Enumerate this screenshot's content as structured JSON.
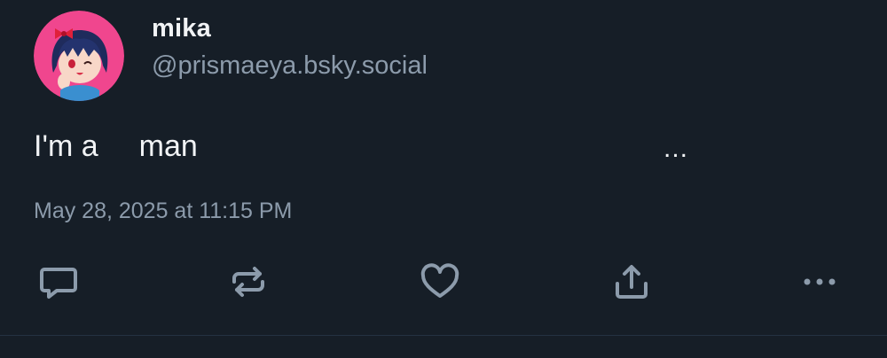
{
  "post": {
    "author": {
      "display_name": "mika",
      "handle": "@prismaeya.bsky.social",
      "avatar_icon": "anime-avatar"
    },
    "text_before": "I'm a",
    "text_after": "man",
    "inline_menu": "...",
    "timestamp": "May 28, 2025 at 11:15 PM"
  },
  "actions": {
    "reply_icon": "reply-icon",
    "repost_icon": "repost-icon",
    "like_icon": "heart-icon",
    "share_icon": "share-icon",
    "more_icon": "more-options-icon"
  },
  "colors": {
    "background": "#161e27",
    "primary_text": "#f1f3f5",
    "secondary_text": "#8c9bab",
    "icon": "#8c9bab",
    "avatar_bg": "#f0468e"
  }
}
